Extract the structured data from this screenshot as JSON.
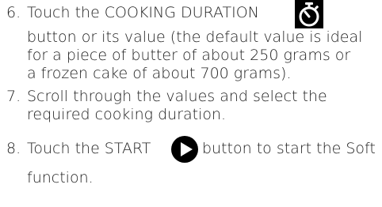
{
  "steps": [
    {
      "number": "6.",
      "lines": [
        "Touch the COOKING DURATION",
        "button or its value (the default value is ideal",
        "for a piece of butter of about 250 grams or",
        "a frozen cake of about 700 grams)."
      ],
      "icon": "stopwatch-icon"
    },
    {
      "number": "7.",
      "lines": [
        "Scroll through the values and select the",
        "required cooking duration."
      ]
    },
    {
      "number": "8.",
      "lines": [
        "Touch the START",
        "button to start the Soft",
        "function."
      ],
      "icon": "play-icon"
    }
  ],
  "colors": {
    "text": "#1e1e1e",
    "icon_background": "#000000",
    "icon_foreground": "#ffffff"
  }
}
